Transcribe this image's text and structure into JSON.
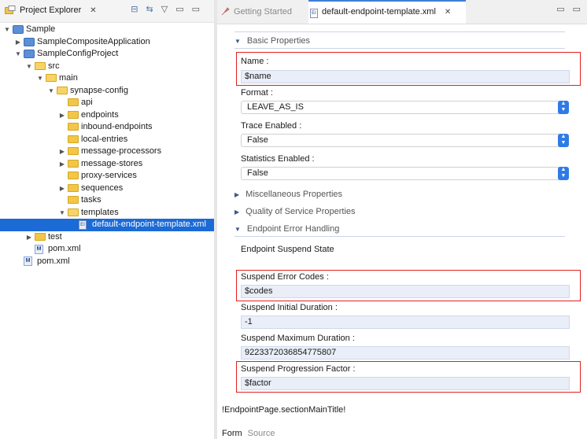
{
  "left_panel": {
    "title": "Project Explorer",
    "close_glyph": "✕",
    "tools": [
      "⊟",
      "⇆",
      "▽",
      "▭",
      "▭"
    ]
  },
  "tree": [
    {
      "label": "Sample",
      "indent": 0,
      "twisty": "▼",
      "icon": "project"
    },
    {
      "label": "SampleCompositeApplication",
      "indent": 1,
      "twisty": "▶",
      "icon": "project"
    },
    {
      "label": "SampleConfigProject",
      "indent": 1,
      "twisty": "▼",
      "icon": "project"
    },
    {
      "label": "src",
      "indent": 2,
      "twisty": "▼",
      "icon": "folder"
    },
    {
      "label": "main",
      "indent": 3,
      "twisty": "▼",
      "icon": "folder"
    },
    {
      "label": "synapse-config",
      "indent": 4,
      "twisty": "▼",
      "icon": "folder"
    },
    {
      "label": "api",
      "indent": 5,
      "twisty": "",
      "icon": "folder"
    },
    {
      "label": "endpoints",
      "indent": 5,
      "twisty": "▶",
      "icon": "folder"
    },
    {
      "label": "inbound-endpoints",
      "indent": 5,
      "twisty": "",
      "icon": "folder"
    },
    {
      "label": "local-entries",
      "indent": 5,
      "twisty": "",
      "icon": "folder"
    },
    {
      "label": "message-processors",
      "indent": 5,
      "twisty": "▶",
      "icon": "folder"
    },
    {
      "label": "message-stores",
      "indent": 5,
      "twisty": "▶",
      "icon": "folder"
    },
    {
      "label": "proxy-services",
      "indent": 5,
      "twisty": "",
      "icon": "folder"
    },
    {
      "label": "sequences",
      "indent": 5,
      "twisty": "▶",
      "icon": "folder"
    },
    {
      "label": "tasks",
      "indent": 5,
      "twisty": "",
      "icon": "folder"
    },
    {
      "label": "templates",
      "indent": 5,
      "twisty": "▼",
      "icon": "folder"
    },
    {
      "label": "default-endpoint-template.xml",
      "indent": 6,
      "twisty": "",
      "icon": "xml",
      "selected": true
    },
    {
      "label": "test",
      "indent": 2,
      "twisty": "▶",
      "icon": "folder"
    },
    {
      "label": "pom.xml",
      "indent": 2,
      "twisty": "",
      "icon": "maven"
    },
    {
      "label": "pom.xml",
      "indent": 1,
      "twisty": "",
      "icon": "maven"
    }
  ],
  "editor": {
    "tabs": [
      {
        "label": "Getting Started",
        "active": false
      },
      {
        "label": "default-endpoint-template.xml",
        "active": true
      }
    ],
    "close_glyph": "✕",
    "tools": [
      "▭",
      "▭"
    ]
  },
  "form": {
    "sections": {
      "basic": "Basic Properties",
      "misc": "Miscellaneous Properties",
      "qos": "Quality of Service Properties",
      "error": "Endpoint Error Handling"
    },
    "name_label": "Name :",
    "name_value": "$name",
    "format_label": "Format :",
    "format_value": "LEAVE_AS_IS",
    "trace_label": "Trace Enabled :",
    "trace_value": "False",
    "stats_label": "Statistics Enabled :",
    "stats_value": "False",
    "suspend_state_label": "Endpoint Suspend State",
    "codes_label": "Suspend Error Codes :",
    "codes_value": "$codes",
    "initial_label": "Suspend Initial Duration :",
    "initial_value": "-1",
    "max_label": "Suspend Maximum Duration :",
    "max_value": "9223372036854775807",
    "factor_label": "Suspend Progression Factor :",
    "factor_value": "$factor",
    "main_title": "!EndpointPage.sectionMainTitle!"
  },
  "bottom_tabs": {
    "form": "Form",
    "source": "Source"
  },
  "colors": {
    "selection": "#1b6ad6",
    "highlight": "#e01f1f",
    "select_button": "#2f7be6"
  }
}
